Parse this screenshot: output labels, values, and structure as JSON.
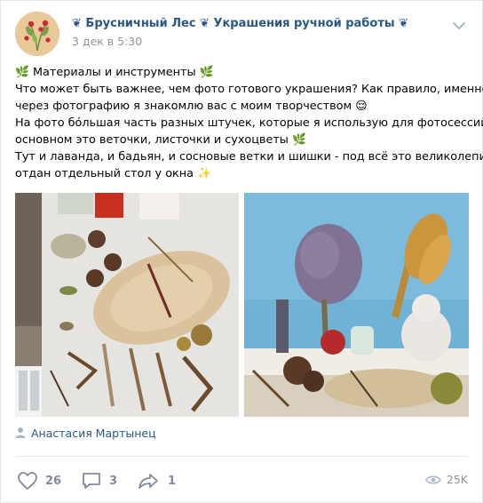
{
  "post": {
    "group_name": "❦ Брусничный Лес ❦ Украшения ручной работы ❦",
    "date": "3 дек в 5:30",
    "text_lines": [
      "🌿 Материалы и инструменты 🌿",
      "Что может быть важнее, чем фото готового украшения? Как правило, именно",
      "через фотографию я знакомлю вас с моим творчеством 😌",
      "На фото бóльшая часть разных штучек, которые я использую для фотосессий, в",
      "основном это веточки, листочки и сухоцветы 🌿",
      "Тут и лаванда, и бадьян, и сосновые ветки и шишки - под всё это великолепие",
      "отдан отдельный стол у окна ✨"
    ],
    "signer": "Анастасия Мартынец",
    "likes": "26",
    "comments": "3",
    "shares": "1",
    "views": "25K"
  },
  "colors": {
    "link": "#2a5885",
    "muted": "#828a99",
    "divider": "#e7e8ec"
  },
  "icons": {
    "menu": "chevron-down-icon",
    "signer": "person-icon",
    "like": "heart-icon",
    "comment": "comment-icon",
    "share": "share-arrow-icon",
    "views": "eye-icon"
  }
}
